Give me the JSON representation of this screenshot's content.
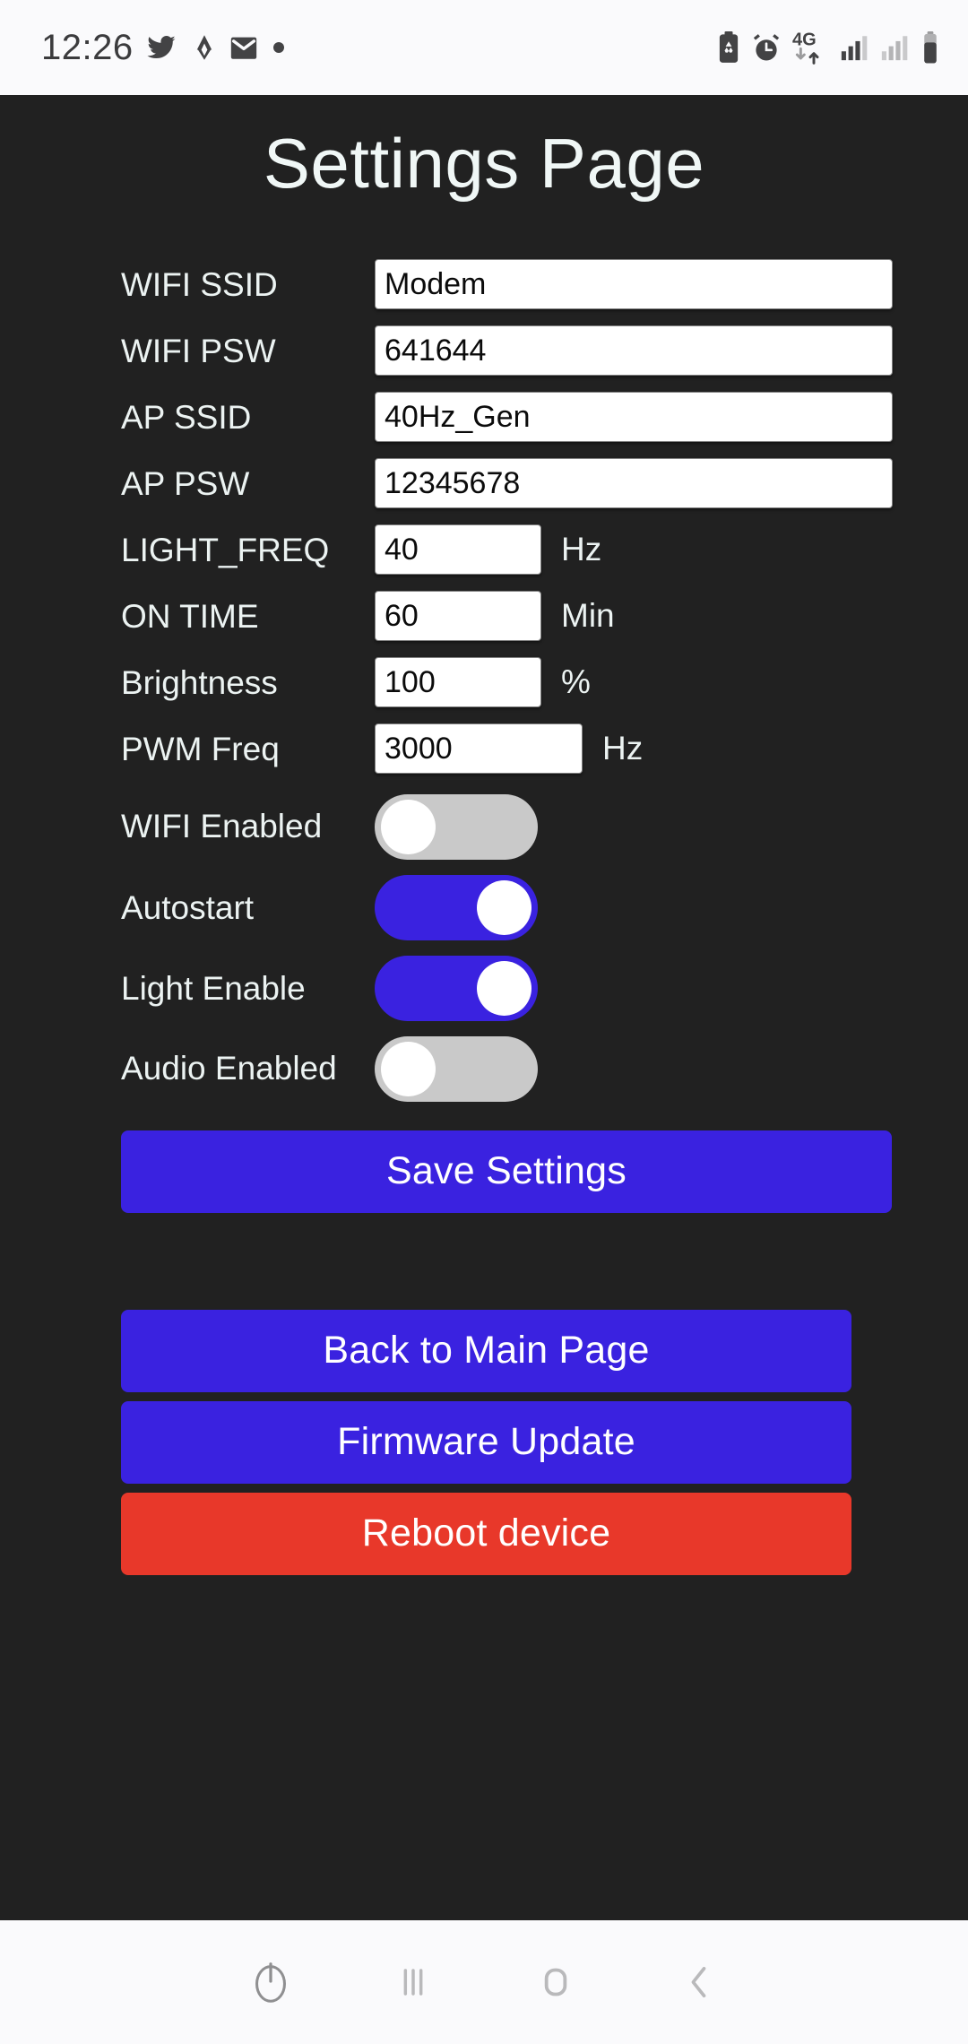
{
  "statusbar": {
    "time": "12:26",
    "left_icons": [
      "twitter-icon",
      "strava-icon",
      "mail-icon",
      "dot-icon"
    ],
    "right_icons": [
      "battery-saver-icon",
      "alarm-icon",
      "4g-data-icon",
      "signal-1-icon",
      "signal-2-icon",
      "battery-icon"
    ],
    "network_label": "4G"
  },
  "page": {
    "title": "Settings Page",
    "background": "#212121",
    "accent": "#3a22e0",
    "danger": "#e8382a",
    "toggle_off": "#c9c9c9"
  },
  "fields": [
    {
      "label": "WIFI SSID",
      "value": "Modem",
      "unit": "",
      "size": "wide"
    },
    {
      "label": "WIFI PSW",
      "value": "641644",
      "unit": "",
      "size": "wide"
    },
    {
      "label": "AP SSID",
      "value": "40Hz_Gen",
      "unit": "",
      "size": "wide"
    },
    {
      "label": "AP PSW",
      "value": "12345678",
      "unit": "",
      "size": "wide"
    },
    {
      "label": "LIGHT_FREQ",
      "value": "40",
      "unit": "Hz",
      "size": "small"
    },
    {
      "label": "ON TIME",
      "value": "60",
      "unit": "Min",
      "size": "small"
    },
    {
      "label": "Brightness",
      "value": "100",
      "unit": "%",
      "size": "small"
    },
    {
      "label": "PWM Freq",
      "value": "3000",
      "unit": "Hz",
      "size": "med"
    }
  ],
  "toggles": [
    {
      "label": "WIFI Enabled",
      "state": "off"
    },
    {
      "label": "Autostart",
      "state": "on"
    },
    {
      "label": "Light Enable",
      "state": "on"
    },
    {
      "label": "Audio Enabled",
      "state": "off"
    }
  ],
  "buttons": {
    "save": "Save Settings",
    "back": "Back to Main Page",
    "firmware": "Firmware Update",
    "reboot": "Reboot device"
  },
  "navbar": {
    "items": [
      "power-icon",
      "recents-icon",
      "home-icon",
      "back-icon"
    ]
  }
}
